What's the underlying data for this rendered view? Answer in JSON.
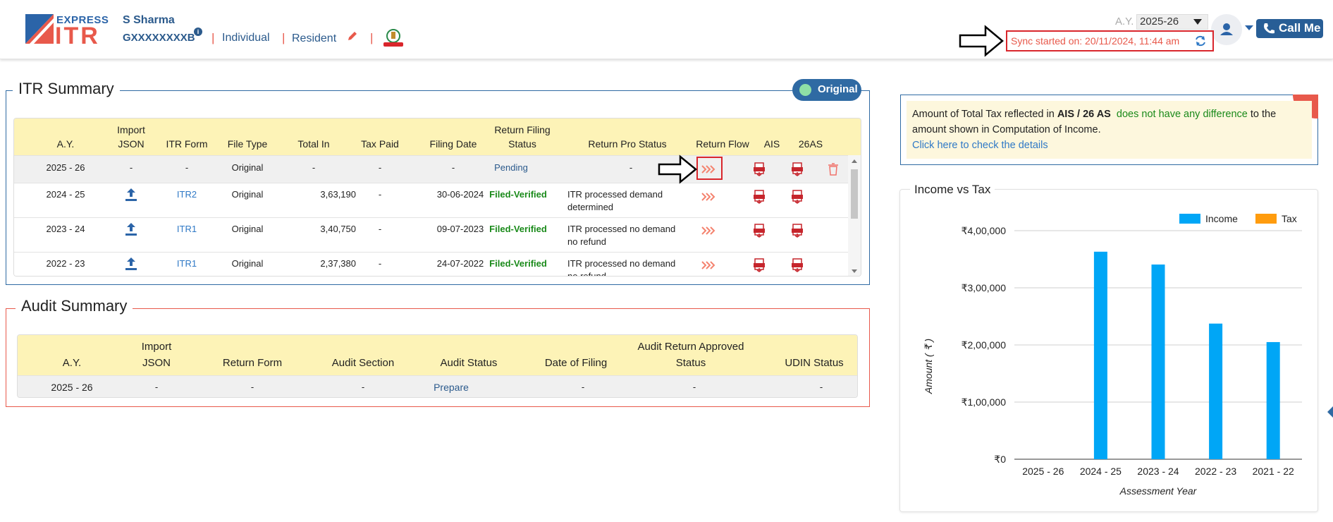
{
  "app": {
    "logo_express": "EXPRESS",
    "logo_itr": "ITR"
  },
  "user": {
    "name": "S Sharma",
    "pan": "GXXXXXXXXB",
    "type": "Individual",
    "residency": "Resident"
  },
  "header": {
    "ay_label": "A.Y.",
    "ay_value": "2025-26",
    "call_me": "Call Me",
    "sync_text": "Sync started on: 20/11/2024, 11:44 am"
  },
  "itr_summary": {
    "title": "ITR Summary",
    "badge": "Original",
    "headers": {
      "ay": "A.Y.",
      "import_json_1": "Import",
      "import_json_2": "JSON",
      "itr_form": "ITR Form",
      "file_type": "File Type",
      "total_in": "Total In",
      "tax_paid": "Tax Paid",
      "filing_date": "Filing Date",
      "rfs_1": "Return Filing",
      "rfs_2": "Status",
      "pro_status": "Return Pro Status",
      "return_flow": "Return Flow",
      "ais": "AIS",
      "as26": "26AS"
    },
    "rows": [
      {
        "ay": "2025 - 26",
        "import_json": "-",
        "itr_form": "-",
        "file_type": "Original",
        "total_in": "-",
        "tax_paid": "-",
        "filing_date": "-",
        "status": "Pending",
        "pro_status_1": "-",
        "pro_status_2": ""
      },
      {
        "ay": "2024 - 25",
        "import_json": "",
        "itr_form": "ITR2",
        "file_type": "Original",
        "total_in": "3,63,190",
        "tax_paid": "-",
        "filing_date": "30-06-2024",
        "status": "Filed-Verified",
        "pro_status_1": "ITR processed demand",
        "pro_status_2": "determined"
      },
      {
        "ay": "2023 - 24",
        "import_json": "",
        "itr_form": "ITR1",
        "file_type": "Original",
        "total_in": "3,40,750",
        "tax_paid": "-",
        "filing_date": "09-07-2023",
        "status": "Filed-Verified",
        "pro_status_1": "ITR processed no demand",
        "pro_status_2": "no refund"
      },
      {
        "ay": "2022 - 23",
        "import_json": "",
        "itr_form": "ITR1",
        "file_type": "Original",
        "total_in": "2,37,380",
        "tax_paid": "-",
        "filing_date": "24-07-2022",
        "status": "Filed-Verified",
        "pro_status_1": "ITR processed no demand",
        "pro_status_2": "no refund"
      }
    ]
  },
  "audit_summary": {
    "title": "Audit Summary",
    "headers": {
      "ay": "A.Y.",
      "import_1": "Import",
      "import_2": "JSON",
      "return_form": "Return Form",
      "audit_section": "Audit Section",
      "audit_status": "Audit Status",
      "date_of_filing": "Date of Filing",
      "approved_1": "Audit Return Approved",
      "approved_2": "Status",
      "udin": "UDIN Status"
    },
    "row": {
      "ay": "2025 - 26",
      "import": "-",
      "return_form": "-",
      "audit_section": "-",
      "audit_status": "Prepare",
      "date_of_filing": "-",
      "approved": "-",
      "udin": "-"
    }
  },
  "tax_note": {
    "part1": "Amount of Total Tax reflected in ",
    "bold": "AIS / 26 AS",
    "green": "does not have any difference",
    "part2": " to the amount shown in Computation of Income.",
    "link": "Click here to check the details"
  },
  "chart_data": {
    "type": "bar",
    "title": "Income vs Tax",
    "xlabel": "Assessment Year",
    "ylabel": "Amount ( ₹ )",
    "categories": [
      "2025 - 26",
      "2024 - 25",
      "2023 - 24",
      "2022 - 23",
      "2021 - 22"
    ],
    "series": [
      {
        "name": "Income",
        "color": "#00a6f6",
        "values": [
          0,
          363190,
          340750,
          237380,
          205000
        ]
      },
      {
        "name": "Tax",
        "color": "#ff9c0e",
        "values": [
          0,
          0,
          0,
          0,
          0
        ]
      }
    ],
    "ylim": [
      0,
      400000
    ],
    "yticks": [
      0,
      100000,
      200000,
      300000,
      400000
    ],
    "ytick_labels": [
      "₹0",
      "₹1,00,000",
      "₹2,00,000",
      "₹3,00,000",
      "₹4,00,000"
    ],
    "legend": "top-right",
    "grid": true
  }
}
